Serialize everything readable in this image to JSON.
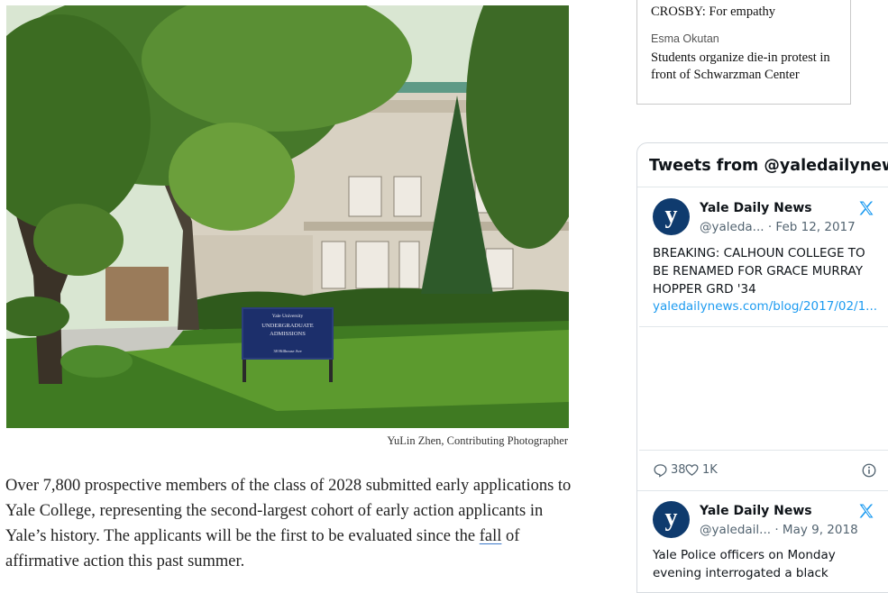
{
  "photo": {
    "sign_line1": "Yale University",
    "sign_line2": "UNDERGRADUATE",
    "sign_line3": "ADMISSIONS",
    "sign_line4": "38 Hillhouse Ave"
  },
  "caption": "YuLin Zhen, Contributing Photographer",
  "article": {
    "text_before_link": "Over 7,800 prospective members of the class of 2028 submitted early applications to Yale College, representing the second-largest cohort of early action applicants in Yale’s history. The applicants will be the first to be evaluated since the ",
    "link_text": "fall",
    "text_after_link": " of affirmative action this past summer."
  },
  "related": {
    "item1_headline": "CROSBY: For empathy",
    "item2_author": "Esma Okutan",
    "item2_headline": "Students organize die-in protest in front of Schwarzman Center"
  },
  "twitter": {
    "header": "Tweets from @yaledailynews",
    "avatar_letter": "y",
    "tweets": [
      {
        "name": "Yale Daily News",
        "handle": "@yaleda...",
        "date": "· Feb 12, 2017",
        "text": "BREAKING: CALHOUN COLLEGE TO BE RENAMED FOR GRACE MURRAY HOPPER GRD '34",
        "link": "yaledailynews.com/blog/2017/02/1...",
        "replies": "38",
        "likes": "1K"
      },
      {
        "name": "Yale Daily News",
        "handle": "@yaledail...",
        "date": "· May 9, 2018",
        "text": "Yale Police officers on Monday evening interrogated a black"
      }
    ]
  },
  "colors": {
    "twitter_blue": "#1d9bf0",
    "yale_blue": "#0f3b6e"
  }
}
